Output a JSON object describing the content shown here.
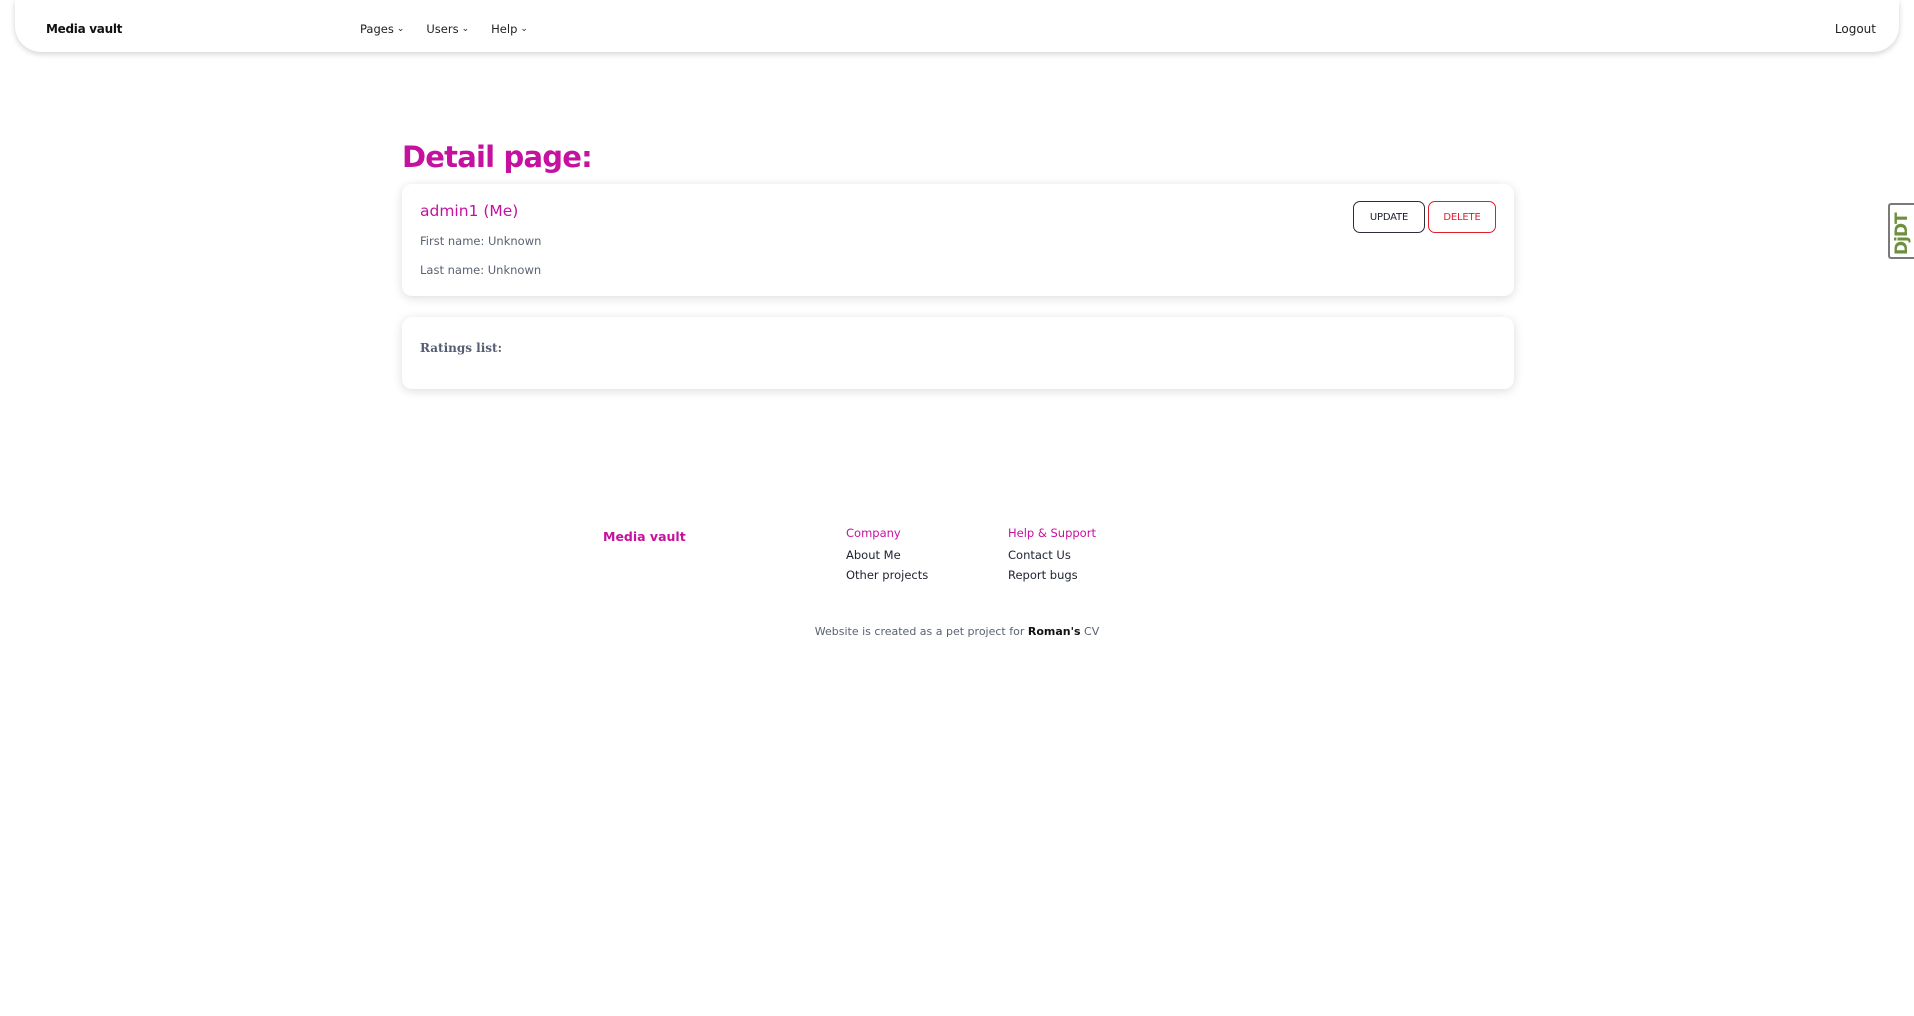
{
  "navbar": {
    "brand": "Media vault",
    "menu": [
      {
        "label": "Pages"
      },
      {
        "label": "Users"
      },
      {
        "label": "Help"
      }
    ],
    "logout": "Logout"
  },
  "main": {
    "title": "Detail page:",
    "user": {
      "username": "admin1 (Me)",
      "first_name": "First name: Unknown",
      "last_name": "Last name: Unknown",
      "update_label": "UPDATE",
      "delete_label": "DELETE"
    },
    "ratings": {
      "label": "Ratings list:"
    }
  },
  "debug_toolbar": {
    "label": "DjDT"
  },
  "footer": {
    "brand": "Media vault",
    "company": {
      "heading": "Company",
      "links": [
        "About Me",
        "Other projects"
      ]
    },
    "help": {
      "heading": "Help & Support",
      "links": [
        "Contact Us",
        "Report bugs"
      ]
    },
    "credits": {
      "prefix": "Website is created as a pet project for ",
      "name": "Roman's",
      "suffix": " CV"
    }
  },
  "colors": {
    "accent": "#c5119f",
    "danger": "#e11d2a",
    "muted_text": "#5a6272"
  }
}
